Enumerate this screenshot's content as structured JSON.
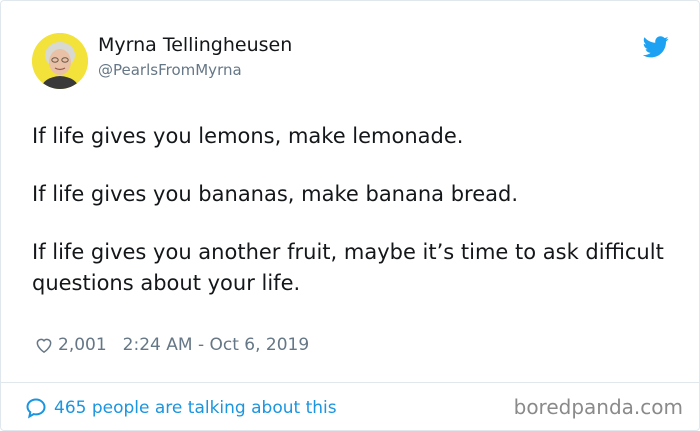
{
  "tweet": {
    "display_name": "Myrna Tellingheusen",
    "handle": "@PearlsFromMyrna",
    "paragraphs": [
      "If life gives you lemons, make lemonade.",
      "If life gives you bananas, make banana bread.",
      "If life gives you another fruit, maybe it’s time to ask difficult questions about your life."
    ],
    "likes": "2,001",
    "timestamp": "2:24 AM - Oct 6, 2019",
    "talking": "465 people are talking about this"
  },
  "watermark": "boredpanda.com",
  "icons": {
    "bird": "twitter-bird-icon",
    "heart": "heart-icon",
    "bubble": "speech-bubble-icon"
  },
  "colors": {
    "accent": "#1da1f2",
    "link": "#1b95e0",
    "muted": "#657786",
    "avatar_bg": "#f2e23a"
  }
}
